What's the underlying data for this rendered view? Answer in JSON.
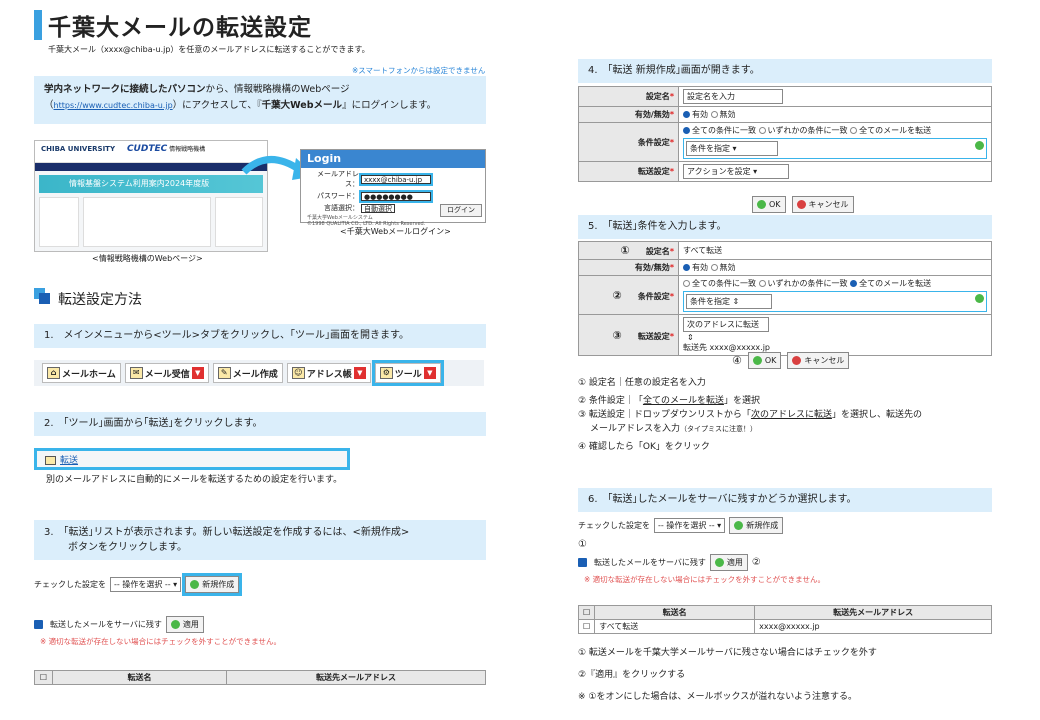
{
  "title": "千葉大メールの転送設定",
  "subtitle": "千葉大メール（xxxx@chiba-u.jp）を任意のメールアドレスに転送することができます。",
  "smartphone_note": "※スマートフォンからは設定できません",
  "intro": {
    "line1_bold": "学内ネットワークに接続したパソコン",
    "line1_rest": "から、情報戦略機構のWebページ",
    "line2_open": "（",
    "url": "https://www.cudtec.chiba-u.jp",
    "line2_mid": "）にアクセスして、『",
    "line2_bold": "千葉大Webメール",
    "line2_end": "』にログインします。"
  },
  "website": {
    "univ": "CHIBA UNIVERSITY",
    "brand": "CUDTEC",
    "dept": "情報戦略機構",
    "banner": "情報基盤システム利用案内2024年度版",
    "caption": "<情報戦略機構のWebページ>"
  },
  "login": {
    "header": "Login",
    "mail_label": "メールアドレス：",
    "mail_value": "xxxx@chiba-u.jp",
    "pass_label": "パスワード：",
    "pass_value": "●●●●●●●●",
    "lang_label": "言語選択：",
    "lang_value": "自動選択",
    "footer1": "千葉大学Webメールシステム",
    "footer2": "©1998 QUALITIA CO., LTD. All Rights Reserved.",
    "button": "ログイン",
    "caption": "<千葉大Webメールログイン>"
  },
  "section_title": "転送設定方法",
  "step1": "1.　メインメニューから<ツール>タブをクリックし、｢ツール｣画面を開きます。",
  "toolbar": [
    "メールホーム",
    "メール受信",
    "メール作成",
    "アドレス帳",
    "ツール"
  ],
  "step2": "2.　｢ツール｣画面から｢転送｣をクリックします。",
  "forward_link": "転送",
  "forward_desc": "別のメールアドレスに自動的にメールを転送するための設定を行います。",
  "step3_l1": "3.　｢転送｣リストが表示されます。新しい転送設定を作成するには、<新規作成>",
  "step3_l2": "ボタンをクリックします。",
  "checked_label": "チェックした設定を",
  "op_select": "-- 操作を選択 --",
  "new_button": "新規作成",
  "keep_label": "転送したメールをサーバに残す",
  "apply_button": "適用",
  "warn": "※ 適切な転送が存在しない場合にはチェックを外すことができません。",
  "col_name": "転送名",
  "col_addr": "転送先メールアドレス",
  "step4": "4.　｢転送 新規作成｣画面が開きます。",
  "form4": {
    "name_label": "設定名",
    "name_value": "設定名を入力",
    "enable_label": "有効/無効",
    "enable_on": "有効",
    "enable_off": "無効",
    "cond_label": "条件設定",
    "cond_all": "全ての条件に一致",
    "cond_any": "いずれかの条件に一致",
    "cond_mail": "全てのメールを転送",
    "cond_select": "条件を指定",
    "fwd_label": "転送設定",
    "fwd_select": "アクションを設定"
  },
  "ok": "OK",
  "cancel": "キャンセル",
  "step5": "5.　｢転送｣条件を入力します。",
  "form5": {
    "n1": "①",
    "n2": "②",
    "n3": "③",
    "n4": "④",
    "name_value": "すべて転送",
    "fwd_select": "次のアドレスに転送",
    "dest_label": "転送先",
    "dest_value": "xxxx@xxxxx.jp"
  },
  "expl1": "① 設定名｜任意の設定名を入力",
  "expl2_a": "② 条件設定｜「",
  "expl2_u": "全てのメールを転送",
  "expl2_b": "」を選択",
  "expl3_a": "③ 転送設定｜ドロップダウンリストから「",
  "expl3_u": "次のアドレスに転送",
  "expl3_b": "」を選択し、転送先の",
  "expl3_c": "メールアドレスを入力",
  "expl3_small": "（タイプミスに注意！）",
  "expl4": "④ 確認したら「OK」をクリック",
  "step6": "6.　｢転送｣したメールをサーバに残すかどうか選択します。",
  "row_name": "すべて転送",
  "row_addr": "xxxx@xxxxx.jp",
  "note6_1": "① 転送メールを千葉大学メールサーバに残さない場合にはチェックを外す",
  "note6_2": "②『適用』をクリックする",
  "note6_3": "※ ①をオンにした場合は、メールボックスが溢れないよう注意する。"
}
